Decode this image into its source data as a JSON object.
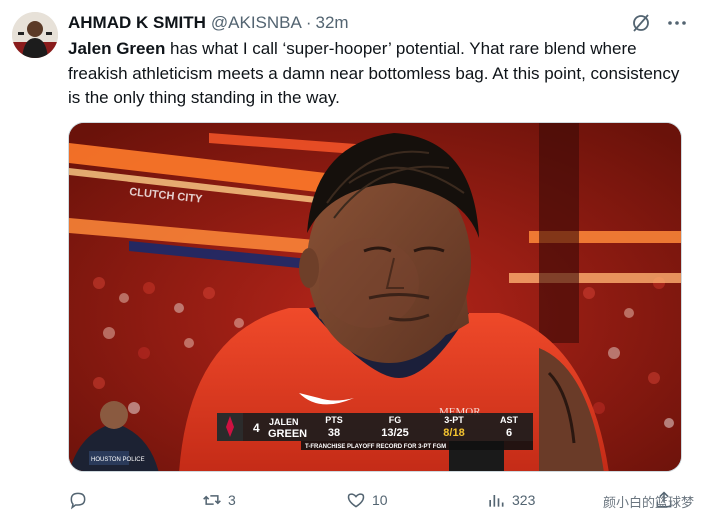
{
  "tweet": {
    "author_name": "AHMAD K SMITH",
    "author_handle": "@AKISNBA",
    "separator": "·",
    "timestamp": "32m",
    "text_bold": "Jalen Green",
    "text_body": " has what I call ‘super-hooper’ potential. Yhat rare blend where freakish athleticism meets a damn near bottomless bag. At this point, consistency is the only thing standing in the way."
  },
  "scorebug": {
    "team_logo": "rockets-logo",
    "jersey_number": "4",
    "first_name": "JALEN",
    "last_name": "GREEN",
    "stats": [
      {
        "label": "PTS",
        "value": "38"
      },
      {
        "label": "FG",
        "value": "13/25"
      },
      {
        "label": "3-PT",
        "value": "8/18"
      },
      {
        "label": "AST",
        "value": "6"
      }
    ],
    "footnote": "T-FRANCHISE PLAYOFF RECORD FOR 3-PT FGM",
    "highlight_color": "#f4c430"
  },
  "media_text": {
    "memorial_sign": "MEMOR",
    "police_patch": "HOUSTON POLICE",
    "arena_banner": "CLUTCH CITY"
  },
  "actions": {
    "reply_count": "",
    "retweet_count": "3",
    "like_count": "10",
    "view_count": "323"
  },
  "watermark": "颜小白的篮球梦",
  "icons": [
    "reply-icon",
    "retweet-icon",
    "like-icon",
    "views-icon",
    "share-icon",
    "grok-icon",
    "more-icon"
  ]
}
